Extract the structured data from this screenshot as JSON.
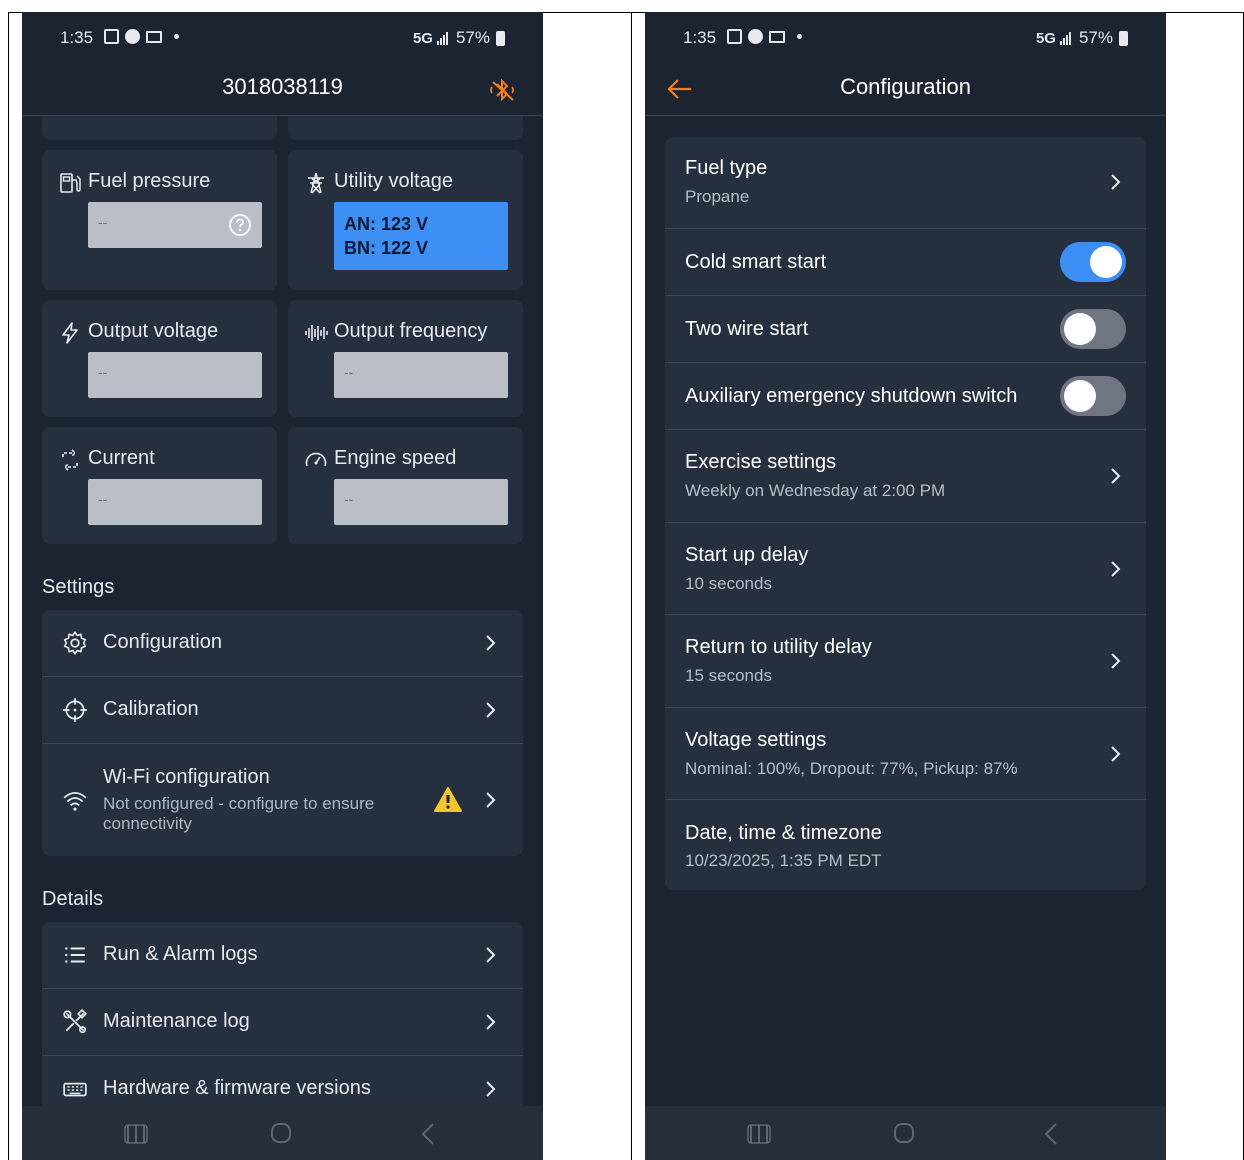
{
  "status": {
    "time": "1:35",
    "network": "5G",
    "battery": "57%"
  },
  "left": {
    "header": {
      "title": "3018038119"
    },
    "tiles": [
      {
        "label": "Fuel pressure",
        "value": "--"
      },
      {
        "label": "Utility voltage",
        "value_line1": "AN: 123 V",
        "value_line2": "BN: 122 V"
      },
      {
        "label": "Output voltage",
        "value": "--"
      },
      {
        "label": "Output frequency",
        "value": "--"
      },
      {
        "label": "Current",
        "value": "--"
      },
      {
        "label": "Engine speed",
        "value": "--"
      }
    ],
    "settings": {
      "heading": "Settings",
      "items": [
        {
          "label": "Configuration"
        },
        {
          "label": "Calibration"
        },
        {
          "label": "Wi-Fi configuration",
          "sub": "Not configured - configure to ensure connectivity"
        }
      ]
    },
    "details": {
      "heading": "Details",
      "items": [
        {
          "label": "Run & Alarm logs"
        },
        {
          "label": "Maintenance log"
        },
        {
          "label": "Hardware & firmware versions"
        }
      ]
    }
  },
  "right": {
    "header": {
      "title": "Configuration"
    },
    "items": [
      {
        "label": "Fuel type",
        "sub": "Propane"
      },
      {
        "label": "Cold smart start",
        "toggle": "on"
      },
      {
        "label": "Two wire start",
        "toggle": "off"
      },
      {
        "label": "Auxiliary emergency shutdown switch",
        "toggle": "off"
      },
      {
        "label": "Exercise settings",
        "sub": "Weekly on Wednesday at 2:00 PM"
      },
      {
        "label": "Start up delay",
        "sub": "10 seconds"
      },
      {
        "label": "Return to utility delay",
        "sub": "15 seconds"
      },
      {
        "label": "Voltage settings",
        "sub": "Nominal: 100%, Dropout: 77%, Pickup: 87%"
      },
      {
        "label": "Date, time & timezone",
        "sub": "10/23/2025, 1:35 PM EDT"
      }
    ]
  },
  "colors": {
    "accent": "#f07d1e",
    "blue": "#3d8ef5",
    "background": "#1c2431",
    "card": "#262f3d"
  },
  "icons": [
    "bluetooth-off-icon",
    "back-arrow-icon",
    "fuel-pump-icon",
    "power-tower-icon",
    "lightning-icon",
    "waveform-icon",
    "cycle-arrows-icon",
    "speedometer-icon",
    "gear-icon",
    "crosshair-icon",
    "wifi-icon",
    "warning-icon",
    "list-icon",
    "tools-icon",
    "keyboard-icon",
    "chevron-right-icon"
  ]
}
